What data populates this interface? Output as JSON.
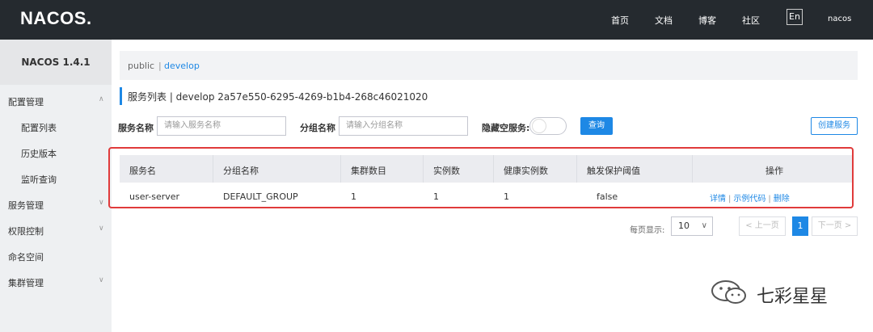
{
  "header": {
    "logo": "NACOS.",
    "nav": [
      "首页",
      "文档",
      "博客",
      "社区"
    ],
    "lang": "En",
    "user": "nacos"
  },
  "sidebar": {
    "version": "NACOS 1.4.1",
    "items": [
      {
        "label": "配置管理",
        "chevron": "∧"
      },
      {
        "label": "配置列表"
      },
      {
        "label": "历史版本"
      },
      {
        "label": "监听查询"
      },
      {
        "label": "服务管理",
        "chevron": "∨"
      },
      {
        "label": "权限控制",
        "chevron": "∨"
      },
      {
        "label": "命名空间"
      },
      {
        "label": "集群管理",
        "chevron": "∨"
      }
    ]
  },
  "breadcrumb": {
    "public": "public",
    "sep": "|",
    "develop": "develop"
  },
  "page": {
    "title": "服务列表 | develop 2a57e550-6295-4269-b1b4-268c46021020"
  },
  "filters": {
    "service_label": "服务名称",
    "service_placeholder": "请输入服务名称",
    "group_label": "分组名称",
    "group_placeholder": "请输入分组名称",
    "hide_empty_label": "隐藏空服务:",
    "search_button": "查询",
    "create_button": "创建服务"
  },
  "table": {
    "columns": [
      "服务名",
      "分组名称",
      "集群数目",
      "实例数",
      "健康实例数",
      "触发保护阈值",
      "操作"
    ],
    "rows": [
      {
        "name": "user-server",
        "group": "DEFAULT_GROUP",
        "clusters": "1",
        "instances": "1",
        "healthy": "1",
        "threshold": "false",
        "ops": [
          "详情",
          "示例代码",
          "删除"
        ]
      }
    ]
  },
  "pagination": {
    "per_page_label": "每页显示:",
    "per_page": "10",
    "prev": "< 上一页",
    "current": "1",
    "next": "下一页 >"
  },
  "watermark": {
    "text": "七彩星星"
  },
  "colors": {
    "accent": "#1e88e5",
    "header_bg": "#252a2f",
    "highlight_border": "#e03b3b"
  }
}
